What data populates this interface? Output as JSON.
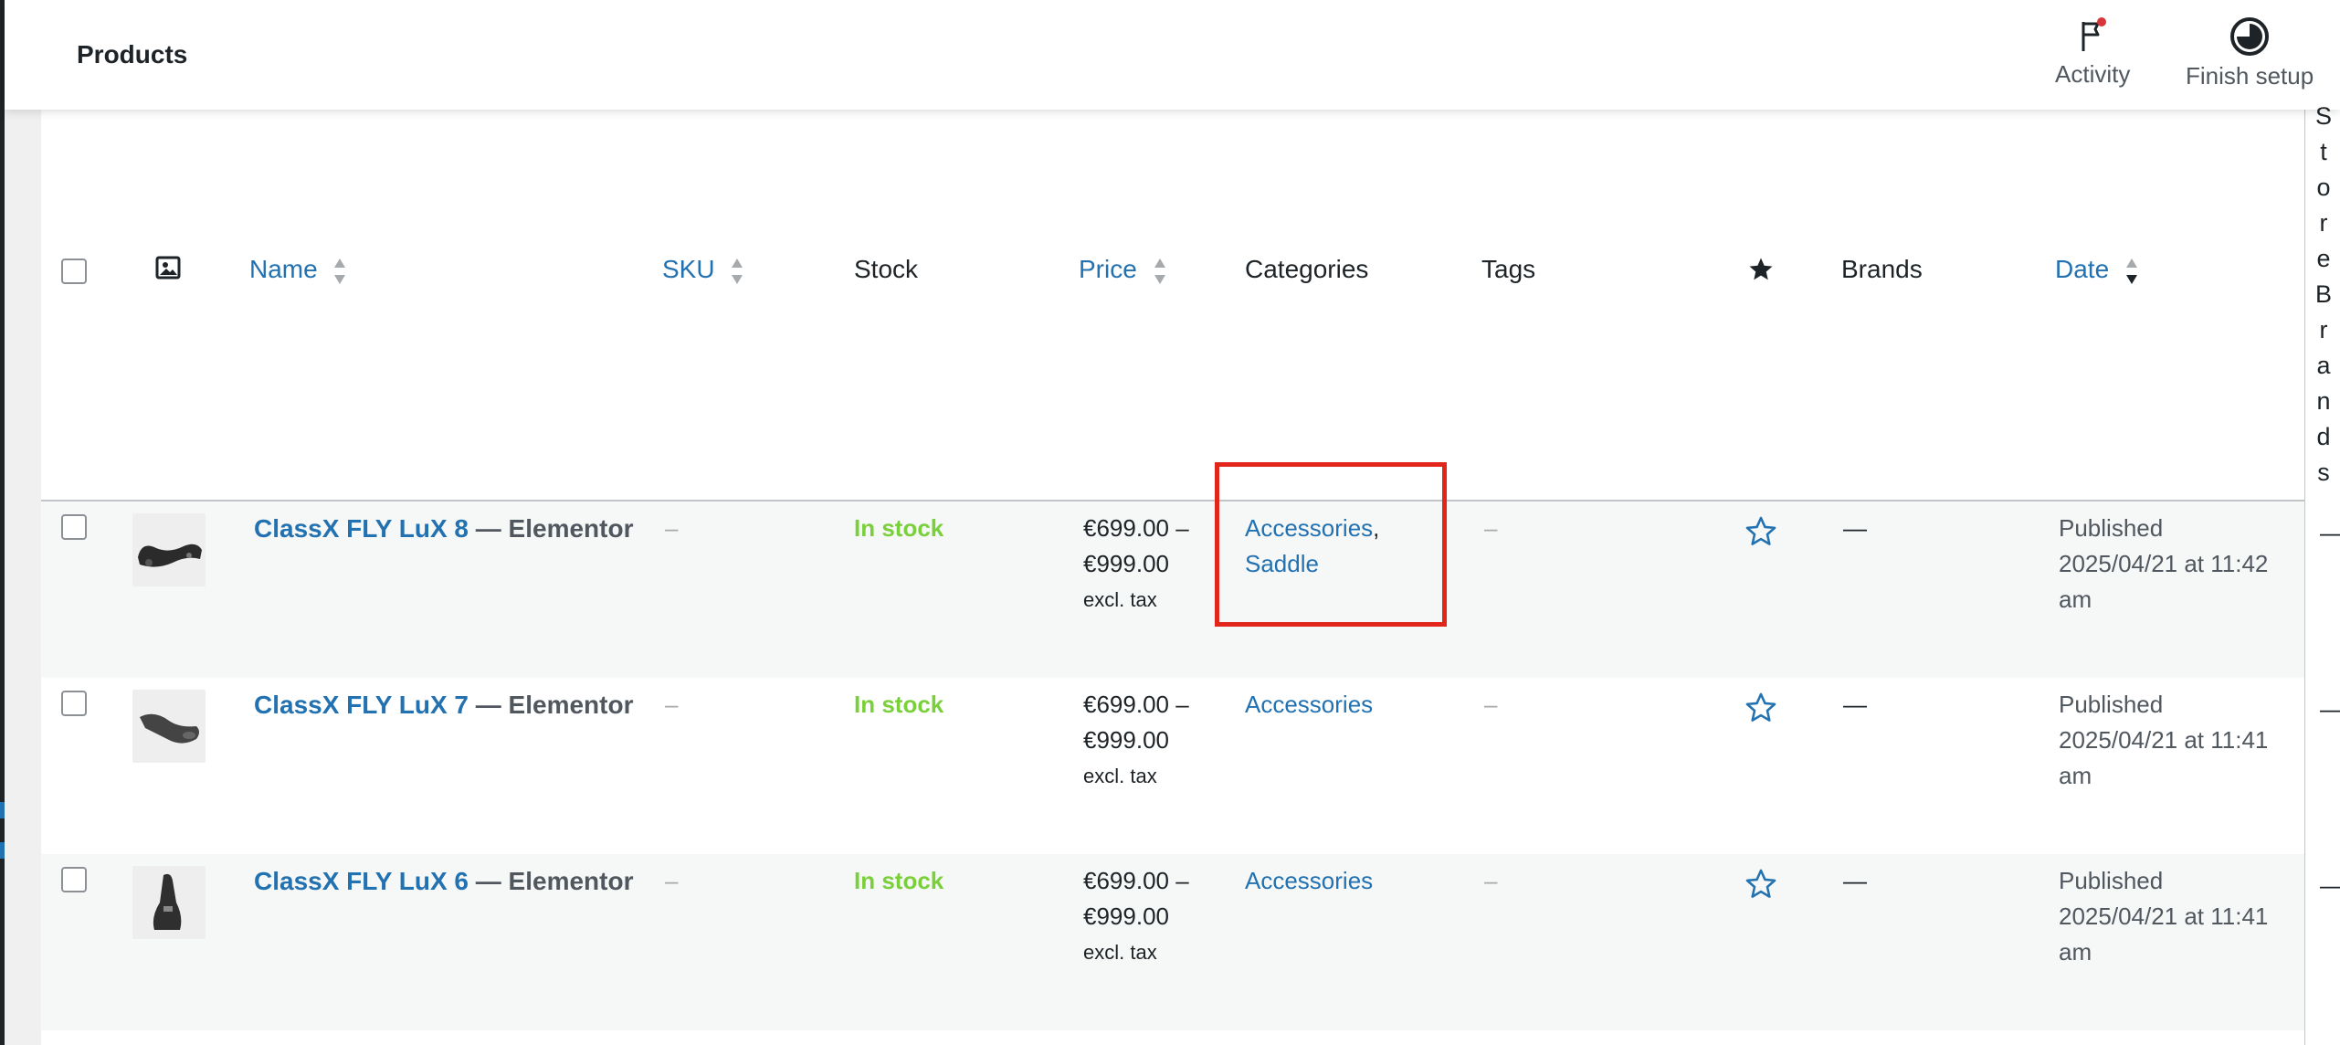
{
  "header": {
    "title": "Products",
    "activity_label": "Activity",
    "finish_setup_label": "Finish setup",
    "notification_color": "#d63638"
  },
  "table": {
    "columns": {
      "image_icon": "image-icon",
      "name": "Name",
      "sku": "SKU",
      "stock": "Stock",
      "price": "Price",
      "categories": "Categories",
      "tags": "Tags",
      "featured_icon": "star-icon",
      "brands": "Brands",
      "date": "Date"
    },
    "rows": [
      {
        "name": "ClassX FLY LuX 8",
        "suffix": "— Elementor",
        "sku": "–",
        "stock": "In stock",
        "price_line1": "€699.00 –",
        "price_line2": "€999.00",
        "price_tax": "excl. tax",
        "category_1": "Accessories",
        "category_sep": ",",
        "category_2": "Saddle",
        "tags": "–",
        "brands": "—",
        "date": "Published 2025/04/21 at 11:42 am",
        "extra": "—"
      },
      {
        "name": "ClassX FLY LuX 7",
        "suffix": "— Elementor",
        "sku": "–",
        "stock": "In stock",
        "price_line1": "€699.00 –",
        "price_line2": "€999.00",
        "price_tax": "excl. tax",
        "category_1": "Accessories",
        "tags": "–",
        "brands": "—",
        "date": "Published 2025/04/21 at 11:41 am",
        "extra": "—"
      },
      {
        "name": "ClassX FLY LuX 6",
        "suffix": "— Elementor",
        "sku": "–",
        "stock": "In stock",
        "price_line1": "€699.00 –",
        "price_line2": "€999.00",
        "price_tax": "excl. tax",
        "category_1": "Accessories",
        "tags": "–",
        "brands": "—",
        "date": "Published 2025/04/21 at 11:41 am",
        "extra": "—"
      }
    ]
  },
  "side_panel": {
    "letters": [
      "S",
      "t",
      "o",
      "r",
      "e",
      "B",
      "r",
      "a",
      "n",
      "d",
      "s"
    ]
  },
  "colors": {
    "link": "#2271b1",
    "in_stock": "#7ad03a",
    "highlight": "#e2261c"
  }
}
